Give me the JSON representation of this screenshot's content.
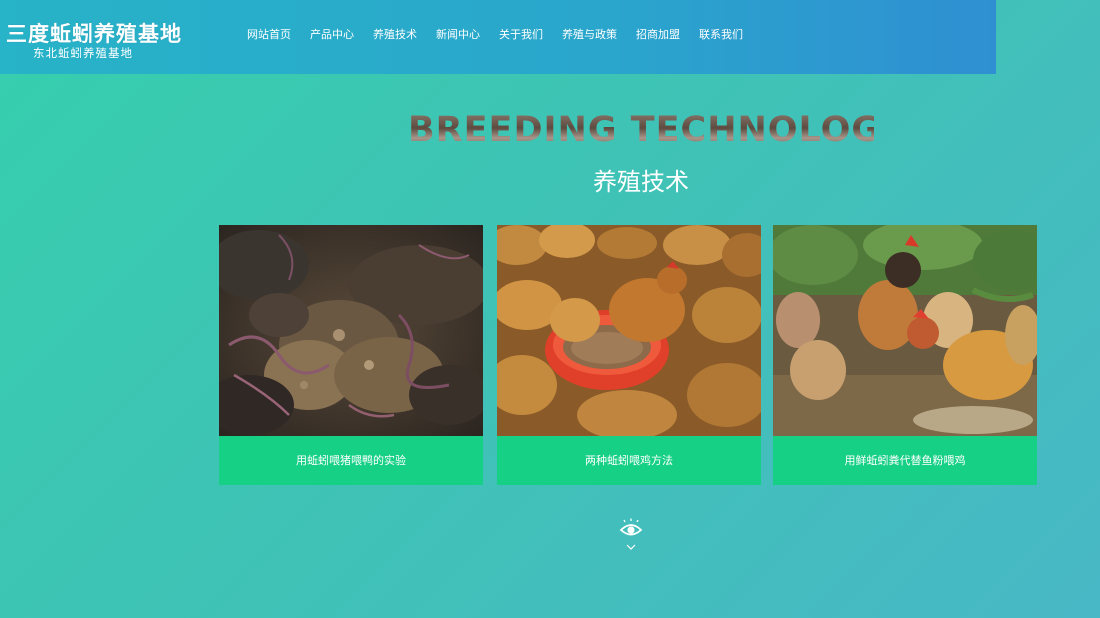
{
  "header": {
    "logo_title": "三度蚯蚓养殖基地",
    "logo_subtitle": "东北蚯蚓养殖基地",
    "nav": [
      {
        "label": "网站首页"
      },
      {
        "label": "产品中心"
      },
      {
        "label": "养殖技术"
      },
      {
        "label": "新闻中心"
      },
      {
        "label": "关于我们"
      },
      {
        "label": "养殖与政策"
      },
      {
        "label": "招商加盟"
      },
      {
        "label": "联系我们"
      }
    ]
  },
  "section": {
    "title_en": "BREEDING TECHNOLOGY",
    "title_cn": "养殖技术"
  },
  "articles": [
    {
      "caption": "用蚯蚓喂猪喂鸭的实验",
      "image": "earthworms-in-soil-photo"
    },
    {
      "caption": "两种蚯蚓喂鸡方法",
      "image": "chickens-eating-from-red-basin-photo"
    },
    {
      "caption": "用鲜蚯蚓粪代替鱼粉喂鸡",
      "image": "free-range-chickens-photo"
    }
  ],
  "more_link": {
    "icon": "eye-icon",
    "arrow": "chevron-down-icon"
  },
  "colors": {
    "header_bg": "#2aa6cc",
    "page_bg": "#3ec4b4",
    "caption_bg": "#16d086"
  }
}
